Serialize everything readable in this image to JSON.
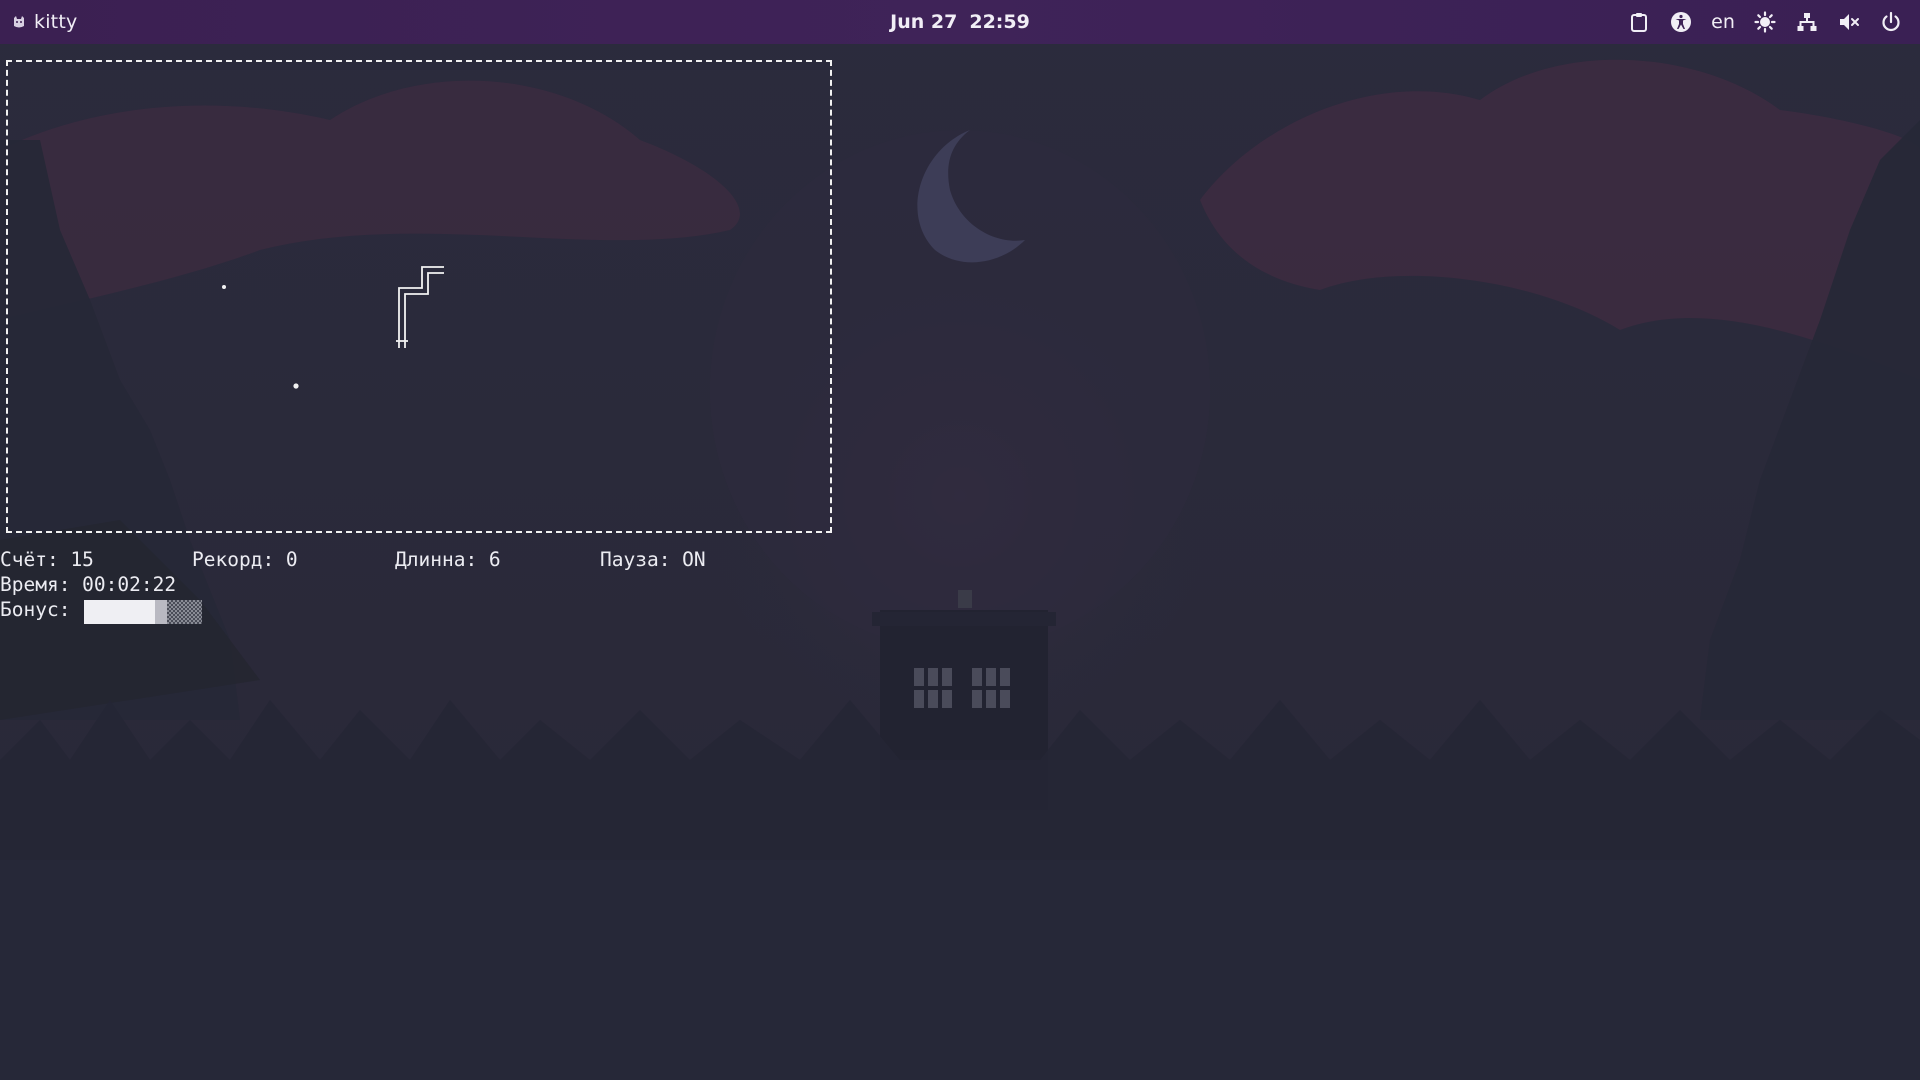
{
  "topbar": {
    "app_name": "kitty",
    "date": "Jun 27",
    "time": "22:59",
    "keyboard_layout": "en",
    "icons": [
      "clipboard-icon",
      "accessibility-icon",
      "brightness-icon",
      "network-icon",
      "volume-muted-icon",
      "power-icon"
    ]
  },
  "game": {
    "score_label": "Счёт: 15",
    "record_label": "Рекорд: 0",
    "length_label": "Длинна: 6",
    "pause_label": "Пауза: ON",
    "time_label": "Время: 00:02:22",
    "bonus_label": "Бонус:",
    "bonus_fraction": 0.6,
    "snake_length": 6,
    "paused": true
  },
  "colors": {
    "topbar_bg": "#3f2358",
    "desktop_bg": "#262838",
    "terminal_text": "#ececf2",
    "border": "#f2f2f2"
  }
}
